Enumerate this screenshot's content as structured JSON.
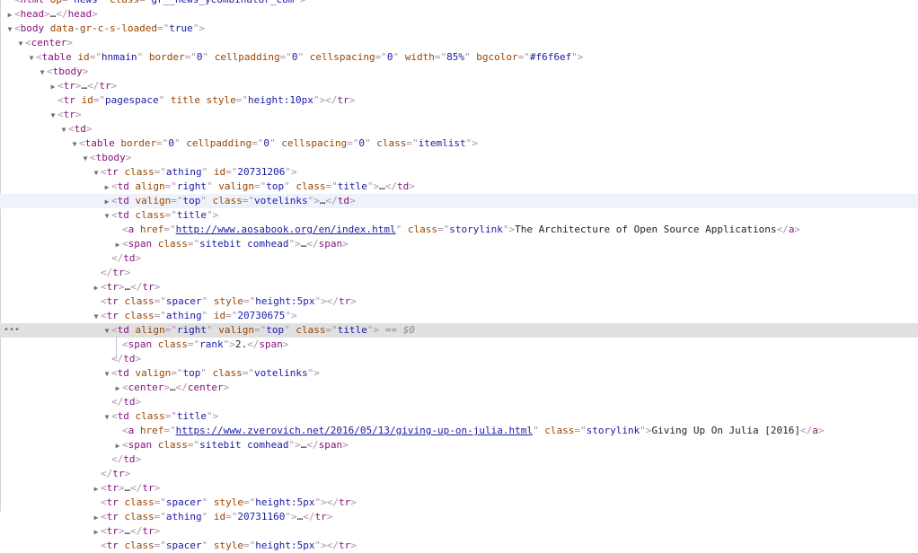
{
  "devtools": {
    "selected_marker": "== $0",
    "more_dots": "•••",
    "lines": [
      {
        "indent": 1,
        "tri": "",
        "html": "<span class='punct'>&lt;</span><span class='tag'>html</span> <span class='attr'>op</span><span class='punct'>=\"</span><span class='val'>news</span><span class='punct'>\"</span> <span class='attr'>class</span><span class='punct'>=\"</span><span class='val'>gr__news_ycombinator_com</span><span class='punct'>\"&gt;</span>"
      },
      {
        "indent": 1,
        "tri": "right",
        "html": "<span class='punct'>&lt;</span><span class='tag'>head</span><span class='punct'>&gt;</span>…<span class='punct'>&lt;/</span><span class='tag'>head</span><span class='punct'>&gt;</span>"
      },
      {
        "indent": 1,
        "tri": "down",
        "html": "<span class='punct'>&lt;</span><span class='tag'>body</span> <span class='attr'>data-gr-c-s-loaded</span><span class='punct'>=\"</span><span class='val'>true</span><span class='punct'>\"&gt;</span>"
      },
      {
        "indent": 2,
        "tri": "down",
        "html": "<span class='punct'>&lt;</span><span class='tag'>center</span><span class='punct'>&gt;</span>"
      },
      {
        "indent": 3,
        "tri": "down",
        "html": "<span class='punct'>&lt;</span><span class='tag'>table</span> <span class='attr'>id</span><span class='punct'>=\"</span><span class='val'>hnmain</span><span class='punct'>\"</span> <span class='attr'>border</span><span class='punct'>=\"</span><span class='val'>0</span><span class='punct'>\"</span> <span class='attr'>cellpadding</span><span class='punct'>=\"</span><span class='val'>0</span><span class='punct'>\"</span> <span class='attr'>cellspacing</span><span class='punct'>=\"</span><span class='val'>0</span><span class='punct'>\"</span> <span class='attr'>width</span><span class='punct'>=\"</span><span class='val'>85%</span><span class='punct'>\"</span> <span class='attr'>bgcolor</span><span class='punct'>=\"</span><span class='val'>#f6f6ef</span><span class='punct'>\"&gt;</span>"
      },
      {
        "indent": 4,
        "tri": "down",
        "html": "<span class='punct'>&lt;</span><span class='tag'>tbody</span><span class='punct'>&gt;</span>"
      },
      {
        "indent": 5,
        "tri": "right",
        "html": "<span class='punct'>&lt;</span><span class='tag'>tr</span><span class='punct'>&gt;</span>…<span class='punct'>&lt;/</span><span class='tag'>tr</span><span class='punct'>&gt;</span>"
      },
      {
        "indent": 5,
        "tri": "",
        "html": "<span class='punct'>&lt;</span><span class='tag'>tr</span> <span class='attr'>id</span><span class='punct'>=\"</span><span class='val'>pagespace</span><span class='punct'>\"</span> <span class='attr'>title</span> <span class='attr'>style</span><span class='punct'>=\"</span><span class='val'>height:10px</span><span class='punct'>\"&gt;&lt;/</span><span class='tag'>tr</span><span class='punct'>&gt;</span>"
      },
      {
        "indent": 5,
        "tri": "down",
        "html": "<span class='punct'>&lt;</span><span class='tag'>tr</span><span class='punct'>&gt;</span>"
      },
      {
        "indent": 6,
        "tri": "down",
        "html": "<span class='punct'>&lt;</span><span class='tag'>td</span><span class='punct'>&gt;</span>"
      },
      {
        "indent": 7,
        "tri": "down",
        "html": "<span class='punct'>&lt;</span><span class='tag'>table</span> <span class='attr'>border</span><span class='punct'>=\"</span><span class='val'>0</span><span class='punct'>\"</span> <span class='attr'>cellpadding</span><span class='punct'>=\"</span><span class='val'>0</span><span class='punct'>\"</span> <span class='attr'>cellspacing</span><span class='punct'>=\"</span><span class='val'>0</span><span class='punct'>\"</span> <span class='attr'>class</span><span class='punct'>=\"</span><span class='val'>itemlist</span><span class='punct'>\"&gt;</span>"
      },
      {
        "indent": 8,
        "tri": "down",
        "html": "<span class='punct'>&lt;</span><span class='tag'>tbody</span><span class='punct'>&gt;</span>"
      },
      {
        "indent": 9,
        "tri": "down",
        "html": "<span class='punct'>&lt;</span><span class='tag'>tr</span> <span class='attr'>class</span><span class='punct'>=\"</span><span class='val'>athing</span><span class='punct'>\"</span> <span class='attr'>id</span><span class='punct'>=\"</span><span class='val'>20731206</span><span class='punct'>\"&gt;</span>"
      },
      {
        "indent": 10,
        "tri": "right",
        "html": "<span class='punct'>&lt;</span><span class='tag'>td</span> <span class='attr'>align</span><span class='punct'>=\"</span><span class='val'>right</span><span class='punct'>\"</span> <span class='attr'>valign</span><span class='punct'>=\"</span><span class='val'>top</span><span class='punct'>\"</span> <span class='attr'>class</span><span class='punct'>=\"</span><span class='val'>title</span><span class='punct'>\"&gt;</span>…<span class='punct'>&lt;/</span><span class='tag'>td</span><span class='punct'>&gt;</span>"
      },
      {
        "indent": 10,
        "tri": "right",
        "state": "hover",
        "html": "<span class='punct'>&lt;</span><span class='tag'>td</span> <span class='attr'>valign</span><span class='punct'>=\"</span><span class='val'>top</span><span class='punct'>\"</span> <span class='attr'>class</span><span class='punct'>=\"</span><span class='val'>votelinks</span><span class='punct'>\"&gt;</span>…<span class='punct'>&lt;/</span><span class='tag'>td</span><span class='punct'>&gt;</span>"
      },
      {
        "indent": 10,
        "tri": "down",
        "html": "<span class='punct'>&lt;</span><span class='tag'>td</span> <span class='attr'>class</span><span class='punct'>=\"</span><span class='val'>title</span><span class='punct'>\"&gt;</span>"
      },
      {
        "indent": 11,
        "tri": "",
        "html": "<span class='punct'>&lt;</span><span class='tag'>a</span> <span class='attr'>href</span><span class='punct'>=\"</span><span class='link'>http://www.aosabook.org/en/index.html</span><span class='punct'>\"</span> <span class='attr'>class</span><span class='punct'>=\"</span><span class='val'>storylink</span><span class='punct'>\"&gt;</span><span class='txt'>The Architecture of Open Source Applications</span><span class='punct'>&lt;/</span><span class='tag'>a</span><span class='punct'>&gt;</span>"
      },
      {
        "indent": 11,
        "tri": "right",
        "html": "<span class='punct'>&lt;</span><span class='tag'>span</span> <span class='attr'>class</span><span class='punct'>=\"</span><span class='val'>sitebit comhead</span><span class='punct'>\"&gt;</span>…<span class='punct'>&lt;/</span><span class='tag'>span</span><span class='punct'>&gt;</span>"
      },
      {
        "indent": 10,
        "tri": "",
        "html": "<span class='punct'>&lt;/</span><span class='tag'>td</span><span class='punct'>&gt;</span>"
      },
      {
        "indent": 9,
        "tri": "",
        "html": "<span class='punct'>&lt;/</span><span class='tag'>tr</span><span class='punct'>&gt;</span>"
      },
      {
        "indent": 9,
        "tri": "right",
        "html": "<span class='punct'>&lt;</span><span class='tag'>tr</span><span class='punct'>&gt;</span>…<span class='punct'>&lt;/</span><span class='tag'>tr</span><span class='punct'>&gt;</span>"
      },
      {
        "indent": 9,
        "tri": "",
        "html": "<span class='punct'>&lt;</span><span class='tag'>tr</span> <span class='attr'>class</span><span class='punct'>=\"</span><span class='val'>spacer</span><span class='punct'>\"</span> <span class='attr'>style</span><span class='punct'>=\"</span><span class='val'>height:5px</span><span class='punct'>\"&gt;&lt;/</span><span class='tag'>tr</span><span class='punct'>&gt;</span>"
      },
      {
        "indent": 9,
        "tri": "down",
        "html": "<span class='punct'>&lt;</span><span class='tag'>tr</span> <span class='attr'>class</span><span class='punct'>=\"</span><span class='val'>athing</span><span class='punct'>\"</span> <span class='attr'>id</span><span class='punct'>=\"</span><span class='val'>20730675</span><span class='punct'>\"&gt;</span>"
      },
      {
        "indent": 10,
        "tri": "down",
        "state": "selected",
        "html": "<span class='punct'>&lt;</span><span class='tag'>td</span> <span class='attr'>align</span><span class='punct'>=\"</span><span class='val'>right</span><span class='punct'>\"</span> <span class='attr'>valign</span><span class='punct'>=\"</span><span class='val'>top</span><span class='punct'>\"</span> <span class='attr'>class</span><span class='punct'>=\"</span><span class='val'>title</span><span class='punct'>\"&gt;</span> <span class='eq'>== $0</span>"
      },
      {
        "indent": 11,
        "tri": "",
        "html": "<span class='punct'>&lt;</span><span class='tag'>span</span> <span class='attr'>class</span><span class='punct'>=\"</span><span class='val'>rank</span><span class='punct'>\"&gt;</span><span class='txt'>2.</span><span class='punct'>&lt;/</span><span class='tag'>span</span><span class='punct'>&gt;</span>"
      },
      {
        "indent": 10,
        "tri": "",
        "html": "<span class='punct'>&lt;/</span><span class='tag'>td</span><span class='punct'>&gt;</span>"
      },
      {
        "indent": 10,
        "tri": "down",
        "html": "<span class='punct'>&lt;</span><span class='tag'>td</span> <span class='attr'>valign</span><span class='punct'>=\"</span><span class='val'>top</span><span class='punct'>\"</span> <span class='attr'>class</span><span class='punct'>=\"</span><span class='val'>votelinks</span><span class='punct'>\"&gt;</span>"
      },
      {
        "indent": 11,
        "tri": "right",
        "html": "<span class='punct'>&lt;</span><span class='tag'>center</span><span class='punct'>&gt;</span>…<span class='punct'>&lt;/</span><span class='tag'>center</span><span class='punct'>&gt;</span>"
      },
      {
        "indent": 10,
        "tri": "",
        "html": "<span class='punct'>&lt;/</span><span class='tag'>td</span><span class='punct'>&gt;</span>"
      },
      {
        "indent": 10,
        "tri": "down",
        "html": "<span class='punct'>&lt;</span><span class='tag'>td</span> <span class='attr'>class</span><span class='punct'>=\"</span><span class='val'>title</span><span class='punct'>\"&gt;</span>"
      },
      {
        "indent": 11,
        "tri": "",
        "html": "<span class='punct'>&lt;</span><span class='tag'>a</span> <span class='attr'>href</span><span class='punct'>=\"</span><span class='link'>https://www.zverovich.net/2016/05/13/giving-up-on-julia.html</span><span class='punct'>\"</span> <span class='attr'>class</span><span class='punct'>=\"</span><span class='val'>storylink</span><span class='punct'>\"&gt;</span><span class='txt'>Giving Up On Julia [2016]</span><span class='punct'>&lt;/</span><span class='tag'>a</span><span class='punct'>&gt;</span>"
      },
      {
        "indent": 11,
        "tri": "right",
        "html": "<span class='punct'>&lt;</span><span class='tag'>span</span> <span class='attr'>class</span><span class='punct'>=\"</span><span class='val'>sitebit comhead</span><span class='punct'>\"&gt;</span>…<span class='punct'>&lt;/</span><span class='tag'>span</span><span class='punct'>&gt;</span>"
      },
      {
        "indent": 10,
        "tri": "",
        "html": "<span class='punct'>&lt;/</span><span class='tag'>td</span><span class='punct'>&gt;</span>"
      },
      {
        "indent": 9,
        "tri": "",
        "html": "<span class='punct'>&lt;/</span><span class='tag'>tr</span><span class='punct'>&gt;</span>"
      },
      {
        "indent": 9,
        "tri": "right",
        "html": "<span class='punct'>&lt;</span><span class='tag'>tr</span><span class='punct'>&gt;</span>…<span class='punct'>&lt;/</span><span class='tag'>tr</span><span class='punct'>&gt;</span>"
      },
      {
        "indent": 9,
        "tri": "",
        "html": "<span class='punct'>&lt;</span><span class='tag'>tr</span> <span class='attr'>class</span><span class='punct'>=\"</span><span class='val'>spacer</span><span class='punct'>\"</span> <span class='attr'>style</span><span class='punct'>=\"</span><span class='val'>height:5px</span><span class='punct'>\"&gt;&lt;/</span><span class='tag'>tr</span><span class='punct'>&gt;</span>"
      },
      {
        "indent": 9,
        "tri": "right",
        "html": "<span class='punct'>&lt;</span><span class='tag'>tr</span> <span class='attr'>class</span><span class='punct'>=\"</span><span class='val'>athing</span><span class='punct'>\"</span> <span class='attr'>id</span><span class='punct'>=\"</span><span class='val'>20731160</span><span class='punct'>\"&gt;</span>…<span class='punct'>&lt;/</span><span class='tag'>tr</span><span class='punct'>&gt;</span>"
      },
      {
        "indent": 9,
        "tri": "right",
        "html": "<span class='punct'>&lt;</span><span class='tag'>tr</span><span class='punct'>&gt;</span>…<span class='punct'>&lt;/</span><span class='tag'>tr</span><span class='punct'>&gt;</span>"
      },
      {
        "indent": 9,
        "tri": "",
        "html": "<span class='punct'>&lt;</span><span class='tag'>tr</span> <span class='attr'>class</span><span class='punct'>=\"</span><span class='val'>spacer</span><span class='punct'>\"</span> <span class='attr'>style</span><span class='punct'>=\"</span><span class='val'>height:5px</span><span class='punct'>\"&gt;&lt;/</span><span class='tag'>tr</span><span class='punct'>&gt;</span>"
      }
    ]
  }
}
